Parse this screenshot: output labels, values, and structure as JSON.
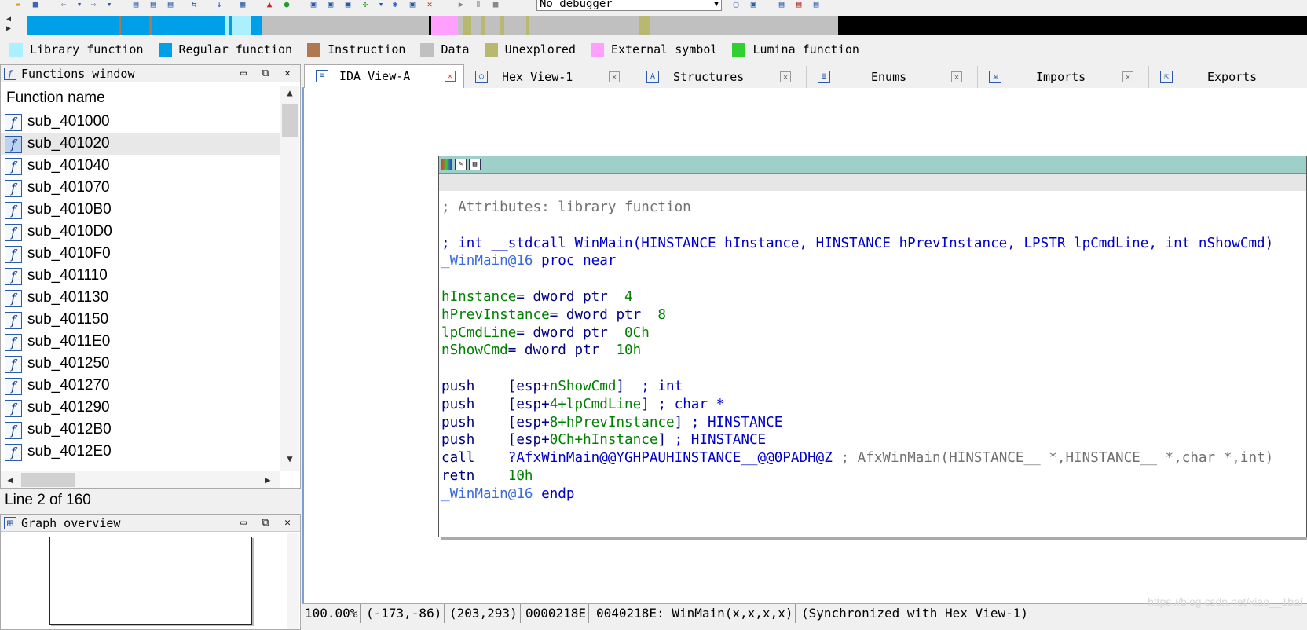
{
  "toolbar": {
    "debugger": "No debugger",
    "icons": [
      "open-icon",
      "save-icon",
      "back-icon",
      "forward-icon",
      "jump-icon",
      "search-icon",
      "run-icon",
      "pause-icon",
      "stop-icon"
    ]
  },
  "nav_band": {
    "colors": {
      "library": "#aaf0ff",
      "regular": "#00a0e8",
      "instruction": "#b07850",
      "data": "#c0c0c0",
      "unexplored": "#b8b870",
      "external": "#ffa0ff",
      "lumina": "#30d030",
      "end": "#000000"
    }
  },
  "legend": [
    {
      "label": "Library function",
      "color": "#aaf0ff"
    },
    {
      "label": "Regular function",
      "color": "#00a0e8"
    },
    {
      "label": "Instruction",
      "color": "#b07850"
    },
    {
      "label": "Data",
      "color": "#c0c0c0"
    },
    {
      "label": "Unexplored",
      "color": "#b8b870"
    },
    {
      "label": "External symbol",
      "color": "#ffa0ff"
    },
    {
      "label": "Lumina function",
      "color": "#30d030"
    }
  ],
  "functions_window": {
    "title": "Functions window",
    "column_header": "Function name",
    "functions": [
      "sub_401000",
      "sub_401020",
      "sub_401040",
      "sub_401070",
      "sub_4010B0",
      "sub_4010D0",
      "sub_4010F0",
      "sub_401110",
      "sub_401130",
      "sub_401150",
      "sub_4011E0",
      "sub_401250",
      "sub_401270",
      "sub_401290",
      "sub_4012B0",
      "sub_4012E0"
    ],
    "selected_index": 1,
    "line_status": "Line 2 of 160"
  },
  "graph_overview": {
    "title": "Graph overview"
  },
  "tabs": [
    {
      "label": "IDA View-A",
      "active": true
    },
    {
      "label": "Hex View-1",
      "active": false
    },
    {
      "label": "Structures",
      "active": false
    },
    {
      "label": "Enums",
      "active": false
    },
    {
      "label": "Imports",
      "active": false
    },
    {
      "label": "Exports",
      "active": false
    }
  ],
  "code": {
    "attributes_comment": "; Attributes: library function",
    "proto_comment": "; int __stdcall WinMain(HINSTANCE hInstance, HINSTANCE hPrevInstance, LPSTR lpCmdLine, int nShowCmd)",
    "proc_label": "_WinMain@16",
    "proc_kw": " proc near",
    "args": [
      {
        "name": "hInstance",
        "decl": "= dword ptr  ",
        "value": "4"
      },
      {
        "name": "hPrevInstance",
        "decl": "= dword ptr  ",
        "value": "8"
      },
      {
        "name": "lpCmdLine",
        "decl": "= dword ptr  ",
        "value": "0Ch"
      },
      {
        "name": "nShowCmd",
        "decl": "= dword ptr  ",
        "value": "10h"
      }
    ],
    "instructions": [
      {
        "mnemonic": "push    ",
        "pre": "[esp+",
        "offset": "",
        "arg": "nShowCmd",
        "post": "]  ",
        "comment": "; int"
      },
      {
        "mnemonic": "push    ",
        "pre": "[esp+",
        "offset": "4+",
        "arg": "lpCmdLine",
        "post": "] ",
        "comment": "; char *"
      },
      {
        "mnemonic": "push    ",
        "pre": "[esp+",
        "offset": "8+",
        "arg": "hPrevInstance",
        "post": "] ",
        "comment": "; HINSTANCE"
      },
      {
        "mnemonic": "push    ",
        "pre": "[esp+",
        "offset": "0Ch+",
        "arg": "hInstance",
        "post": "] ",
        "comment": "; HINSTANCE"
      }
    ],
    "call_mnemonic": "call    ",
    "call_target": "?AfxWinMain@@YGHPAUHINSTANCE__@@0PADH@Z",
    "call_comment": " ; AfxWinMain(HINSTANCE__ *,HINSTANCE__ *,char *,int)",
    "retn_mnemonic": "retn    ",
    "retn_value": "10h",
    "endp_label": "_WinMain@16",
    "endp_kw": " endp"
  },
  "status_bar": {
    "zoom": "100.00%",
    "coords1": "(-173,-86)",
    "coords2": "(203,293)",
    "file_offset": "0000218E",
    "location": "0040218E: WinMain(x,x,x,x)",
    "sync": "(Synchronized with Hex View-1)"
  },
  "watermark": "https://blog.csdn.net/xiao__1bai"
}
